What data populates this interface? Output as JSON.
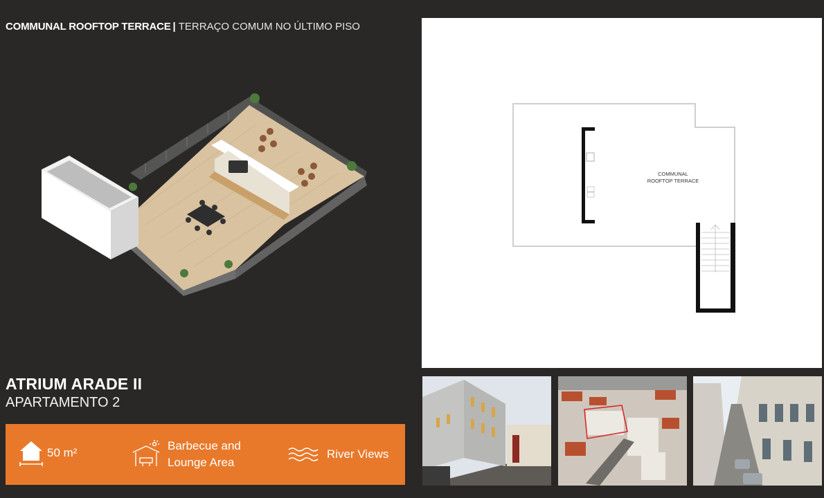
{
  "header": {
    "title_bold": "COMMUNAL ROOFTOP TERRACE",
    "separator": "|",
    "title_light": "TERRAÇO COMUM NO ÚLTIMO PISO"
  },
  "floorplan": {
    "label_line1": "COMMUNAL",
    "label_line2": "ROOFTOP TERRACE"
  },
  "property": {
    "name": "ATRIUM ARADE II",
    "unit": "APARTAMENTO 2"
  },
  "features": [
    {
      "icon": "house-area-icon",
      "label": "50 m²"
    },
    {
      "icon": "barbecue-gazebo-icon",
      "label_line1": "Barbecue and",
      "label_line2": "Lounge Area"
    },
    {
      "icon": "waves-icon",
      "label": "River Views"
    }
  ],
  "colors": {
    "background": "#2a2826",
    "accent": "#e8792a",
    "text": "#ffffff"
  }
}
